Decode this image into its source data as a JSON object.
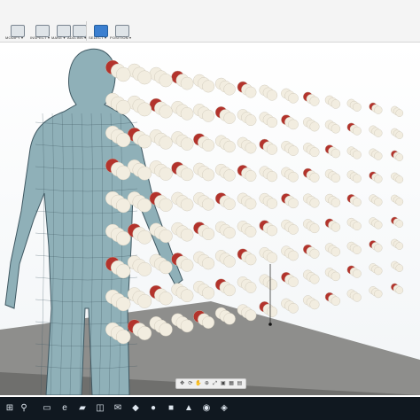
{
  "toolbar": {
    "groups": [
      {
        "label": "MODIFY ▾",
        "icon": "modify-icon"
      },
      {
        "label": "INSPECT ▾",
        "icon": "inspect-icon"
      },
      {
        "label": "MAKE ▾",
        "icon": "make-icon"
      },
      {
        "label": "ADD-INS ▾",
        "icon": "add-ins-icon"
      },
      {
        "label": "SELECT ▾",
        "icon": "select-icon"
      },
      {
        "label": "POSITION ▾",
        "icon": "position-icon"
      }
    ]
  },
  "colors": {
    "body": "#8fb0b8",
    "body_lines": "#3f5862",
    "sphere_white": "#f2ede0",
    "sphere_red": "#b3332c",
    "plate": "#8e8e8c",
    "taskbar": "#101820"
  },
  "nav_bar": {
    "icons": [
      "move-icon",
      "orbit-icon",
      "pan-icon",
      "zoom-icon",
      "fit-icon",
      "display-icon",
      "grid-icon",
      "view-icon"
    ]
  },
  "taskbar": {
    "icons": [
      "windows-icon",
      "search-icon",
      "task-view-icon",
      "edge-icon",
      "folder-icon",
      "store-icon",
      "mail-icon",
      "app-icon-1",
      "app-icon-2",
      "app-icon-3",
      "app-icon-4",
      "app-icon-5",
      "app-icon-6"
    ]
  }
}
